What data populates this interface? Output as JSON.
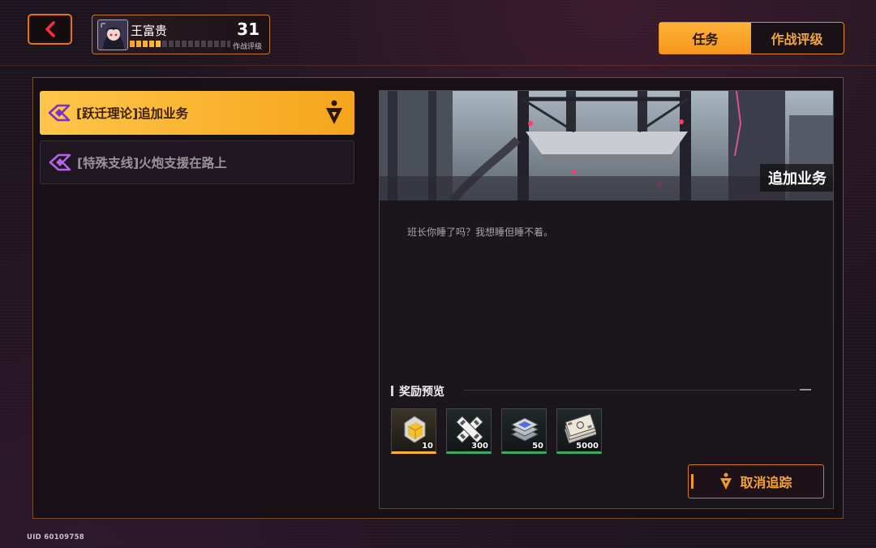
{
  "header": {
    "back_icon": "chevron-left-icon",
    "player": {
      "name": "王富贵",
      "level": "31",
      "level_label": "作战评级",
      "xp_progress": 0.32
    },
    "tabs": [
      {
        "label": "任务",
        "active": true
      },
      {
        "label": "作战评级",
        "active": false
      }
    ]
  },
  "quests": [
    {
      "label": "[跃迁理论]追加业务",
      "active": true,
      "icon": "quest-emblem-icon",
      "tracked": true
    },
    {
      "label": "[特殊支线]火炮支援在路上",
      "active": false,
      "icon": "quest-emblem-icon",
      "tracked": false
    }
  ],
  "detail": {
    "banner_title": "追加业务",
    "description": "班长你睡了吗？我想睡但睡不着。",
    "rewards_title": "奖励预览",
    "rewards": [
      {
        "icon": "gold-cube-icon",
        "qty": "10",
        "rarity": "gold"
      },
      {
        "icon": "crossed-bandage-icon",
        "qty": "300",
        "rarity": "green"
      },
      {
        "icon": "chip-stack-icon",
        "qty": "50",
        "rarity": "green"
      },
      {
        "icon": "cash-bundle-icon",
        "qty": "5000",
        "rarity": "green"
      }
    ],
    "untrack_label": "取消追踪"
  },
  "footer": {
    "uid": "UID 60109758"
  },
  "colors": {
    "accent": "#f5a51c",
    "accent_border": "#e58a25",
    "active_text": "#3a2210",
    "rarity_gold": "#ffb12c",
    "rarity_green": "#3fa766"
  }
}
